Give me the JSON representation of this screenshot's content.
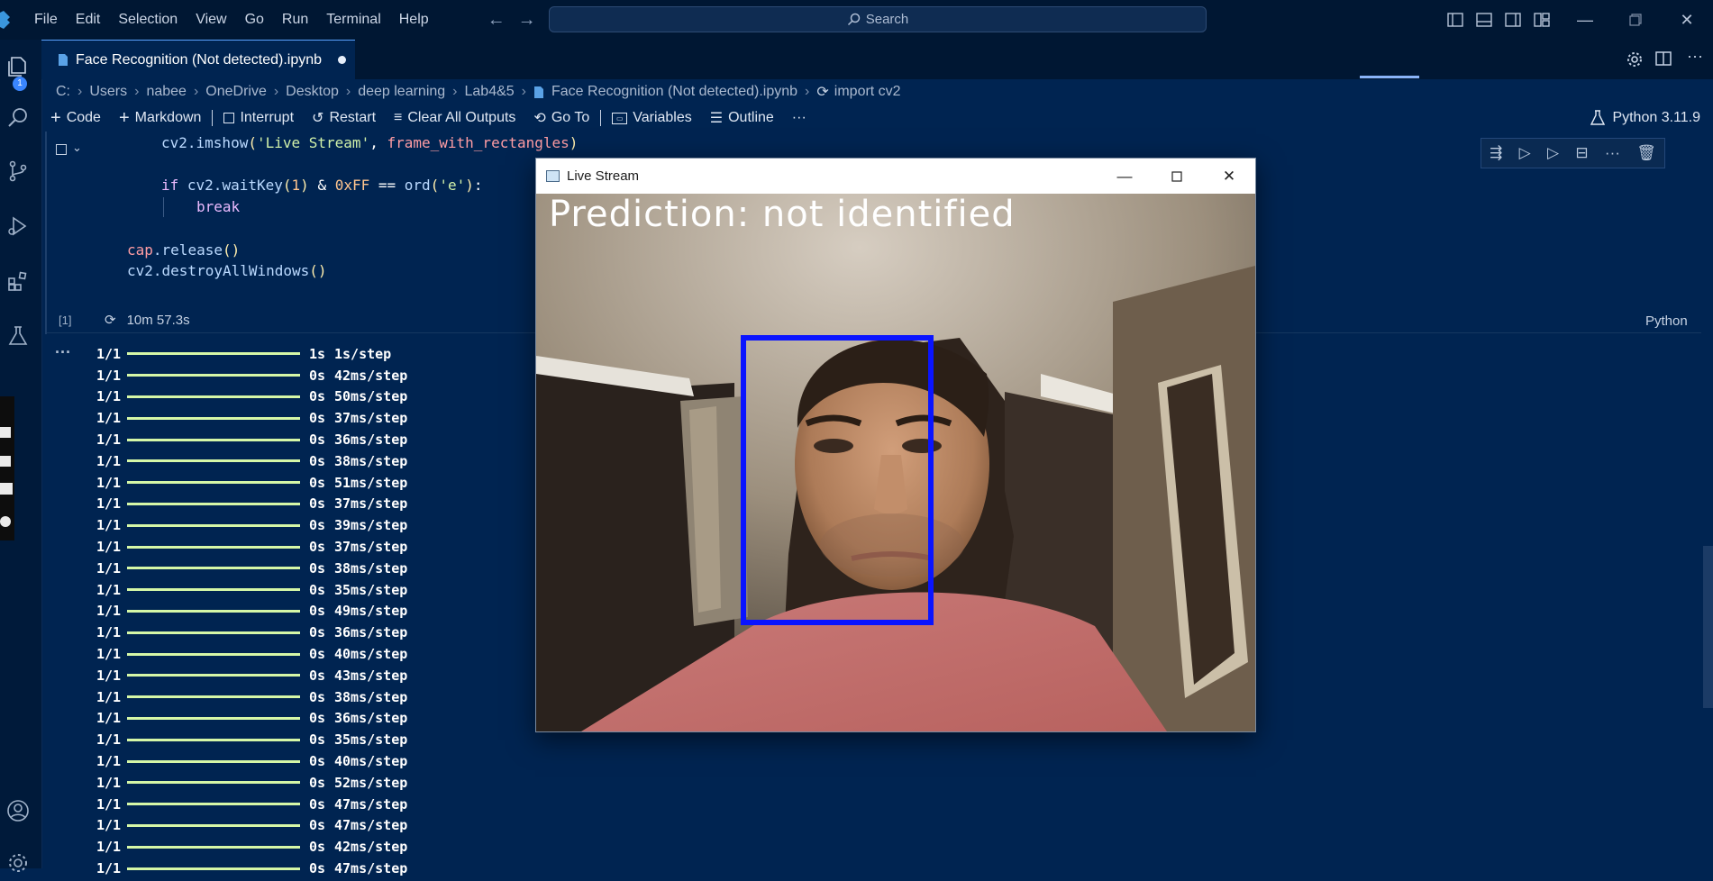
{
  "menu": [
    "File",
    "Edit",
    "Selection",
    "View",
    "Go",
    "Run",
    "Terminal",
    "Help"
  ],
  "search": {
    "label": "Search"
  },
  "activity": {
    "badge": "1"
  },
  "tab": {
    "title": "Face Recognition (Not detected).ipynb"
  },
  "breadcrumb": [
    "C:",
    "Users",
    "nabee",
    "OneDrive",
    "Desktop",
    "deep learning",
    "Lab4&5",
    "Face Recognition (Not detected).ipynb",
    "import cv2"
  ],
  "toolbar": {
    "code": "Code",
    "markdown": "Markdown",
    "interrupt": "Interrupt",
    "restart": "Restart",
    "clear": "Clear All Outputs",
    "goto": "Go To",
    "variables": "Variables",
    "outline": "Outline",
    "more": "···",
    "kernel": "Python 3.11.9"
  },
  "cell": {
    "exec_count": "[1]",
    "exec_time": "10m 57.3s",
    "language": "Python",
    "code": {
      "l1_fn": "cv2.imshow",
      "l1_str": "'Live Stream'",
      "l1_param": "frame_with_rectangles",
      "l2_kw": "if",
      "l2_fn": "cv2.waitKey",
      "l2_n1": "1",
      "l2_mid": "& ",
      "l2_hex": "0xFF",
      "l2_eq": " == ",
      "l2_ord": "ord",
      "l2_str": "'e'",
      "l3_kw": "break",
      "l4_var": "cap",
      "l4_fn": ".release",
      "l5_fn": "cv2.destroyAllWindows"
    }
  },
  "output": {
    "dots": "···",
    "lines": [
      {
        "step": "1/1",
        "time": "1s",
        "rate": "1s/step"
      },
      {
        "step": "1/1",
        "time": "0s",
        "rate": "42ms/step"
      },
      {
        "step": "1/1",
        "time": "0s",
        "rate": "50ms/step"
      },
      {
        "step": "1/1",
        "time": "0s",
        "rate": "37ms/step"
      },
      {
        "step": "1/1",
        "time": "0s",
        "rate": "36ms/step"
      },
      {
        "step": "1/1",
        "time": "0s",
        "rate": "38ms/step"
      },
      {
        "step": "1/1",
        "time": "0s",
        "rate": "51ms/step"
      },
      {
        "step": "1/1",
        "time": "0s",
        "rate": "37ms/step"
      },
      {
        "step": "1/1",
        "time": "0s",
        "rate": "39ms/step"
      },
      {
        "step": "1/1",
        "time": "0s",
        "rate": "37ms/step"
      },
      {
        "step": "1/1",
        "time": "0s",
        "rate": "38ms/step"
      },
      {
        "step": "1/1",
        "time": "0s",
        "rate": "35ms/step"
      },
      {
        "step": "1/1",
        "time": "0s",
        "rate": "49ms/step"
      },
      {
        "step": "1/1",
        "time": "0s",
        "rate": "36ms/step"
      },
      {
        "step": "1/1",
        "time": "0s",
        "rate": "40ms/step"
      },
      {
        "step": "1/1",
        "time": "0s",
        "rate": "43ms/step"
      },
      {
        "step": "1/1",
        "time": "0s",
        "rate": "38ms/step"
      },
      {
        "step": "1/1",
        "time": "0s",
        "rate": "36ms/step"
      },
      {
        "step": "1/1",
        "time": "0s",
        "rate": "35ms/step"
      },
      {
        "step": "1/1",
        "time": "0s",
        "rate": "40ms/step"
      },
      {
        "step": "1/1",
        "time": "0s",
        "rate": "52ms/step"
      },
      {
        "step": "1/1",
        "time": "0s",
        "rate": "47ms/step"
      },
      {
        "step": "1/1",
        "time": "0s",
        "rate": "47ms/step"
      },
      {
        "step": "1/1",
        "time": "0s",
        "rate": "42ms/step"
      },
      {
        "step": "1/1",
        "time": "0s",
        "rate": "47ms/step"
      }
    ]
  },
  "live_window": {
    "title": "Live Stream",
    "prediction": "Prediction: not identified",
    "rect_color": "#0a14ff"
  },
  "colors": {
    "editor_bg": "#002451",
    "titlebar_bg": "#001733",
    "progress_bar": "#d5f7a7"
  }
}
